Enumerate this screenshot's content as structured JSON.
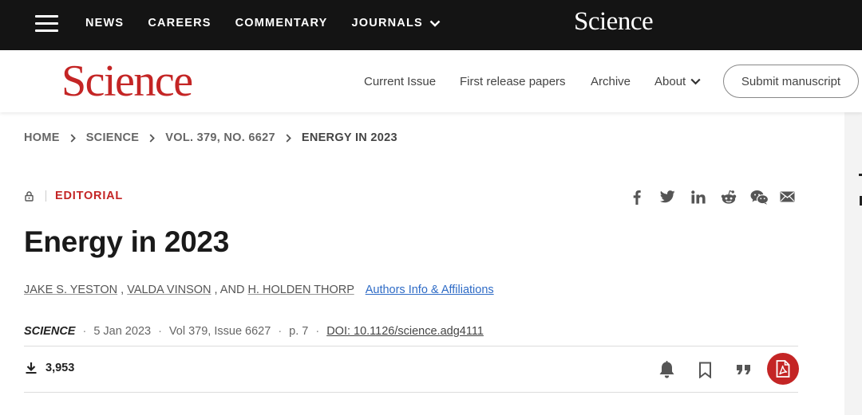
{
  "topbar": {
    "nav": [
      "NEWS",
      "CAREERS",
      "COMMENTARY",
      "JOURNALS"
    ],
    "logo": "Science"
  },
  "header": {
    "logo": "Science",
    "nav": {
      "current_issue": "Current Issue",
      "first_release": "First release papers",
      "archive": "Archive",
      "about": "About"
    },
    "submit": "Submit manuscript"
  },
  "breadcrumb": [
    "HOME",
    "SCIENCE",
    "VOL. 379, NO. 6627",
    "ENERGY IN 2023"
  ],
  "article": {
    "type": "EDITORIAL",
    "title": "Energy in 2023",
    "authors": [
      "JAKE S. YESTON",
      "VALDA VINSON",
      "H. HOLDEN THORP"
    ],
    "author_sep1": " , ",
    "author_sep2": " , AND ",
    "affiliations_link": "Authors Info & Affiliations",
    "journal": "SCIENCE",
    "date": "5 Jan 2023",
    "volume": "Vol 379, Issue 6627",
    "page": "p. 7",
    "doi": "DOI: 10.1126/science.adg4111",
    "downloads": "3,953"
  },
  "share_icons": [
    "facebook-icon",
    "twitter-icon",
    "linkedin-icon",
    "reddit-icon",
    "wechat-icon",
    "email-icon"
  ],
  "tool_icons": [
    "bell-icon",
    "bookmark-icon",
    "quote-icon",
    "pdf-icon"
  ],
  "colors": {
    "brand_red": "#c42525",
    "topbar_bg": "#141414",
    "link_blue": "#2e6bc6"
  }
}
